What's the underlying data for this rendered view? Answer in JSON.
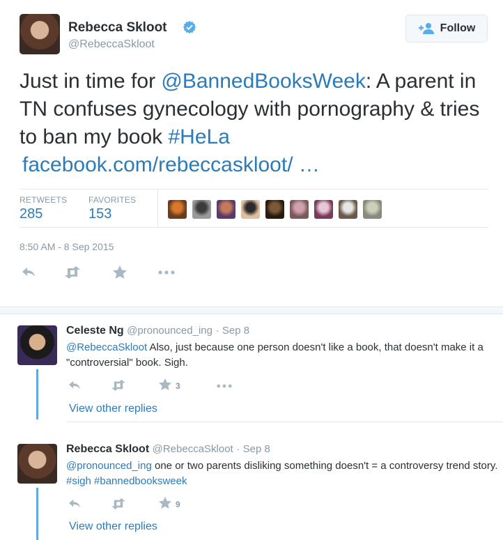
{
  "main_tweet": {
    "author_name": "Rebecca Skloot",
    "author_handle": "@RebeccaSkloot",
    "follow_label": "Follow",
    "text_before": "Just in time for ",
    "mention": "@BannedBooksWeek",
    "text_middle": ": A parent in TN confuses gynecology with pornography & tries to ban my book ",
    "hashtag": "#HeLa",
    "link": "facebook.com/rebeccaskloot/ …",
    "stats": {
      "retweets_label": "RETWEETS",
      "retweets_value": "285",
      "favorites_label": "FAVORITES",
      "favorites_value": "153"
    },
    "timestamp": "8:50 AM - 8 Sep 2015"
  },
  "favoriters": [
    {
      "color_a": "#d9782a",
      "color_b": "#6b3b1c"
    },
    {
      "color_a": "#3b3b3b",
      "color_b": "#9a9a9a"
    },
    {
      "color_a": "#c77a5a",
      "color_b": "#5a3a6a"
    },
    {
      "color_a": "#2a2a2a",
      "color_b": "#e0c0a0"
    },
    {
      "color_a": "#7a5a3a",
      "color_b": "#2a1a0a"
    },
    {
      "color_a": "#d0a0b0",
      "color_b": "#7a5a5a"
    },
    {
      "color_a": "#e6c7d6",
      "color_b": "#7a3a5a"
    },
    {
      "color_a": "#e6e6e6",
      "color_b": "#6a5a4a"
    },
    {
      "color_a": "#c9d2b8",
      "color_b": "#8a8a7a"
    }
  ],
  "replies": [
    {
      "author_name": "Celeste Ng",
      "author_handle": "@pronounced_ing",
      "separator": "·",
      "date": "Sep 8",
      "mention": "@RebeccaSkloot",
      "text": " Also, just because one person doesn't like a book, that doesn't make it a \"controversial\" book. Sigh.",
      "favorite_count": "3",
      "view_replies": "View other replies"
    },
    {
      "author_name": "Rebecca Skloot",
      "author_handle": "@RebeccaSkloot",
      "separator": "·",
      "date": "Sep 8",
      "mention": "@pronounced_ing",
      "text": " one or two parents disliking something doesn't = a controversy trend story. ",
      "hashtag1": "#sigh",
      "hashtag2": "#bannedbooksweek",
      "favorite_count": "9",
      "view_replies": "View other replies"
    }
  ],
  "icons": {
    "reply": "reply-icon",
    "retweet": "retweet-icon",
    "favorite": "star-icon",
    "more": "more-icon",
    "verified": "verified-badge-icon",
    "follow": "add-user-icon"
  },
  "colors": {
    "link": "#2b7bb9",
    "muted": "#8899a6",
    "thread_line": "#5ea9dd",
    "verified": "#55acee"
  }
}
